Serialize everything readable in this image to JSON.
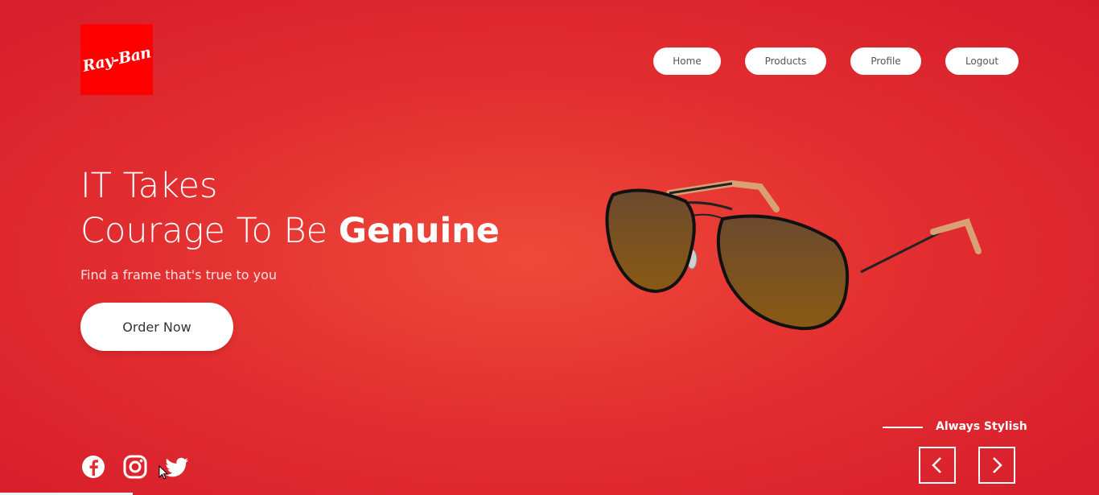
{
  "brand": {
    "logo_text": "Ray-Ban",
    "logo_color": "#fe0000"
  },
  "nav": {
    "items": [
      {
        "label": "Home"
      },
      {
        "label": "Products"
      },
      {
        "label": "Profile"
      },
      {
        "label": "Logout"
      }
    ]
  },
  "hero": {
    "line1": "IT Takes",
    "line2_prefix": "Courage To Be ",
    "line2_bold": "Genuine",
    "subtitle": "Find a frame that's true to you",
    "cta_label": "Order Now"
  },
  "social": {
    "icons": [
      "facebook-icon",
      "instagram-icon",
      "twitter-icon"
    ]
  },
  "slider": {
    "tagline": "Always Stylish",
    "prev_icon": "chevron-left-icon",
    "next_icon": "chevron-right-icon"
  },
  "colors": {
    "background": "#e32f30",
    "accent": "#ffffff"
  }
}
